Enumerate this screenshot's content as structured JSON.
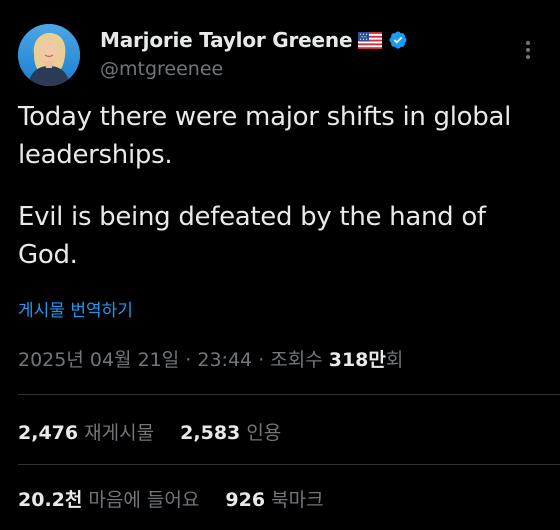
{
  "author": {
    "display_name": "Marjorie Taylor Greene",
    "handle": "@mtgreenee"
  },
  "tweet": {
    "paragraphs": [
      "Today there were major shifts in global leaderships.",
      "Evil is being defeated by the hand of God."
    ],
    "translate_label": "게시물 번역하기"
  },
  "meta": {
    "date": "2025년 04월 21일",
    "separator": "·",
    "time": "23:44",
    "views_label": "조회수",
    "views_number": "318만",
    "views_suffix": "회"
  },
  "stats_row_1": {
    "reposts_count": "2,476",
    "reposts_label": "재게시물",
    "quotes_count": "2,583",
    "quotes_label": "인용"
  },
  "stats_row_2": {
    "likes_count": "20.2천",
    "likes_label": "마음에 들어요",
    "bookmarks_count": "926",
    "bookmarks_label": "북마크"
  },
  "icons": {
    "flag": "us-flag-icon",
    "verified": "verified-badge-icon",
    "more": "more-vertical-icon"
  },
  "colors": {
    "background": "#000000",
    "text": "#e7e9ea",
    "secondary": "#71767b",
    "accent": "#1d9bf0",
    "divider": "#2f3336"
  }
}
